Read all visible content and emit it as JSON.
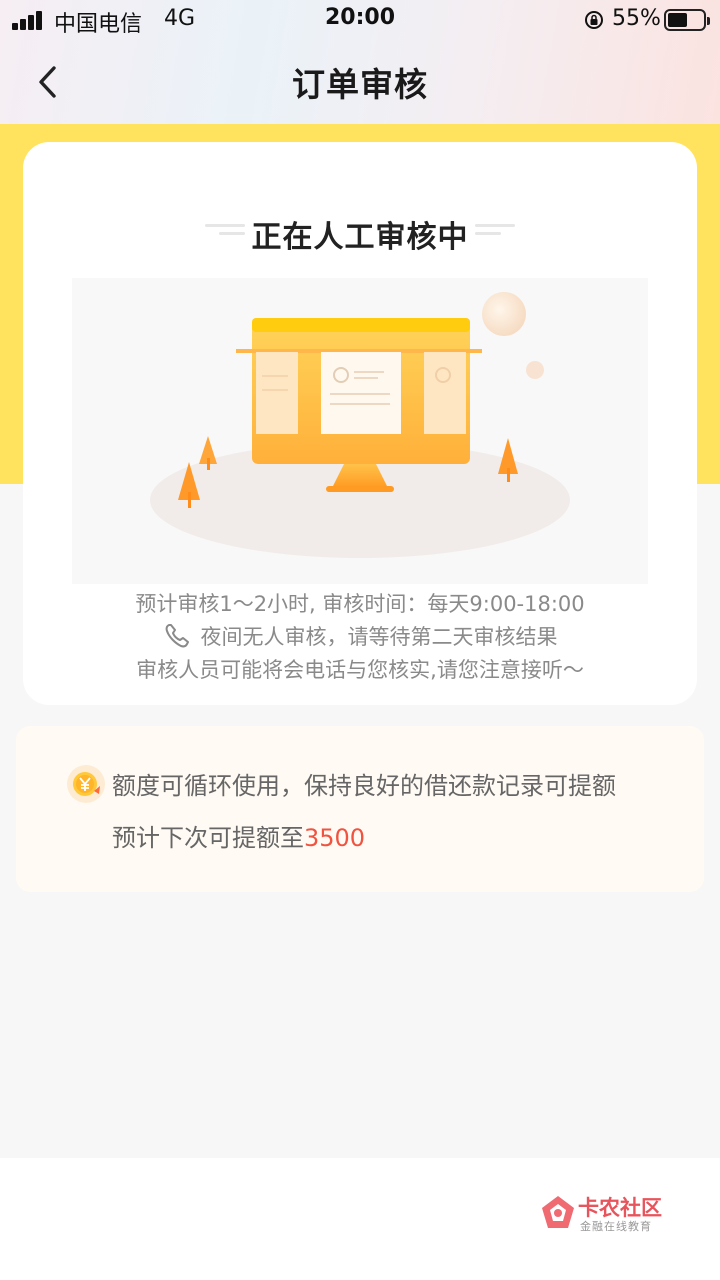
{
  "status_bar": {
    "carrier": "中国电信",
    "network": "4G",
    "time": "20:00",
    "battery_percent": "55%",
    "battery_level": 0.55
  },
  "nav": {
    "title": "订单审核"
  },
  "review_card": {
    "title": "正在人工审核中",
    "info_line1": "预计审核1～2小时, 审核时间：每天9:00-18:00",
    "info_line2": "夜间无人审核，请等待第二天审核结果",
    "info_line3": "审核人员可能将会电话与您核实,请您注意接听～"
  },
  "quota_card": {
    "line1": "额度可循环使用，保持良好的借还款记录可提额",
    "line2_prefix": "预计下次可提额至",
    "amount": "3500"
  },
  "watermark": {
    "name": "卡农社区",
    "subtitle": "金融在线教育"
  },
  "colors": {
    "accent_yellow": "#ffe25e",
    "amount_red": "#f0533f",
    "brand_orange": "#ffa31a"
  }
}
